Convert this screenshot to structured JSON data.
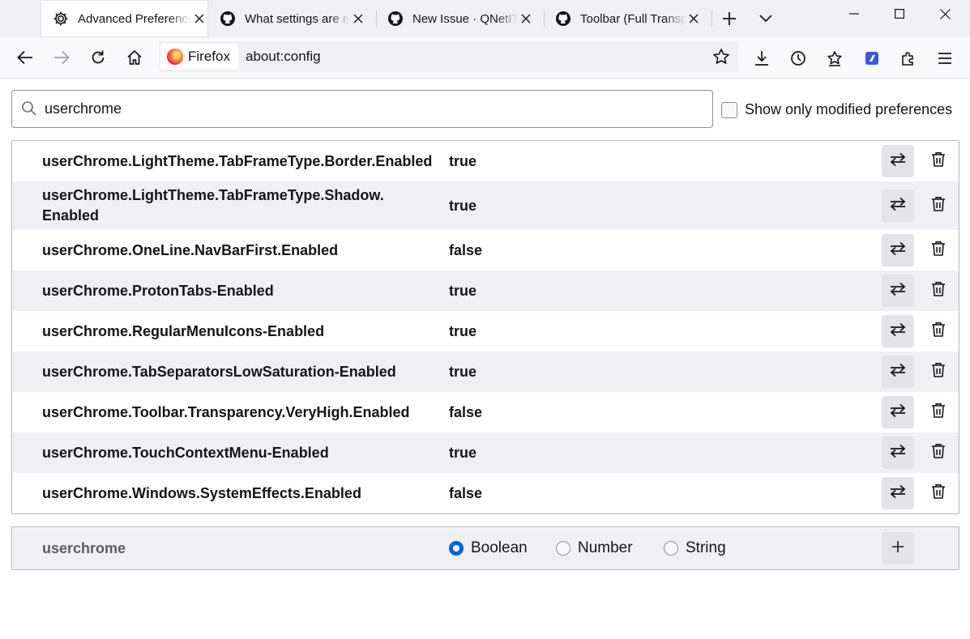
{
  "tabs": [
    {
      "title": "Advanced Preferences",
      "icon": "gear-icon",
      "active": true
    },
    {
      "title": "What settings are required",
      "icon": "github-icon",
      "active": false
    },
    {
      "title": "New Issue · QNetITQ",
      "icon": "github-icon",
      "active": false
    },
    {
      "title": "Toolbar (Full Transparency)",
      "icon": "github-icon",
      "active": false
    }
  ],
  "urlbar": {
    "identity_label": "Firefox",
    "url": "about:config"
  },
  "config": {
    "search_value": "userchrome",
    "show_modified_label": "Show only modified preferences",
    "show_modified_checked": false,
    "prefs": [
      {
        "name": "userChrome.LightTheme.TabFrameType.Border.Enabled",
        "value": "true"
      },
      {
        "name": "userChrome.LightTheme.TabFrameType.Shadow.\nEnabled",
        "value": "true"
      },
      {
        "name": "userChrome.OneLine.NavBarFirst.Enabled",
        "value": "false"
      },
      {
        "name": "userChrome.ProtonTabs-Enabled",
        "value": "true"
      },
      {
        "name": "userChrome.RegularMenuIcons-Enabled",
        "value": "true"
      },
      {
        "name": "userChrome.TabSeparatorsLowSaturation-Enabled",
        "value": "true"
      },
      {
        "name": "userChrome.Toolbar.Transparency.VeryHigh.Enabled",
        "value": "false"
      },
      {
        "name": "userChrome.TouchContextMenu-Enabled",
        "value": "true"
      },
      {
        "name": "userChrome.Windows.SystemEffects.Enabled",
        "value": "false"
      }
    ],
    "new_pref": {
      "name": "userchrome",
      "types": [
        {
          "label": "Boolean",
          "selected": true
        },
        {
          "label": "Number",
          "selected": false
        },
        {
          "label": "String",
          "selected": false
        }
      ]
    }
  },
  "colors": {
    "accent": "#0061e0",
    "tabstrip_bg": "#f0f0f4",
    "row_alt_bg": "#f0f0f4"
  }
}
